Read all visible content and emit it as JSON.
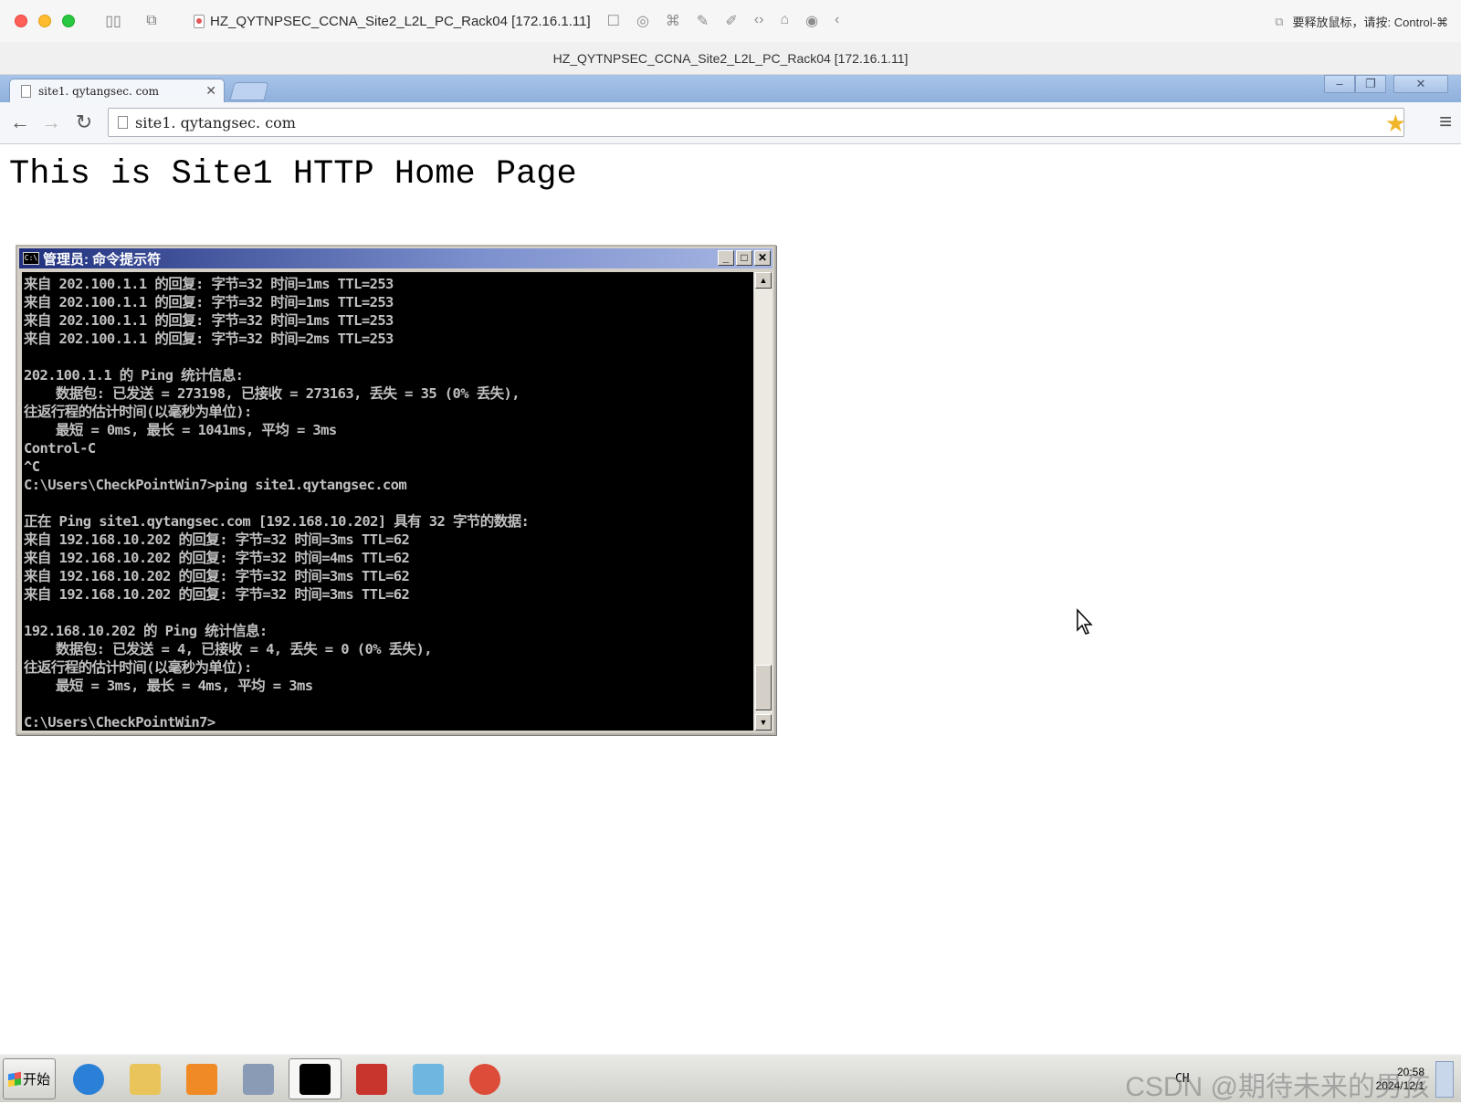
{
  "host_window": {
    "tab_title": "HZ_QYTNPSEC_CCNA_Site2_L2L_PC_Rack04 [172.16.1.11]",
    "subtitle": "HZ_QYTNPSEC_CCNA_Site2_L2L_PC_Rack04 [172.16.1.11]",
    "release_hint": "要释放鼠标，请按: Control-⌘"
  },
  "browser": {
    "tab_label": "site1. qytangsec. com",
    "address": "site1. qytangsec. com",
    "win_buttons": [
      "–",
      "❐",
      "✕"
    ]
  },
  "page": {
    "heading": "This is Site1 HTTP Home Page"
  },
  "cmd": {
    "title": "管理员: 命令提示符",
    "lines": [
      "来自 202.100.1.1 的回复: 字节=32 时间=1ms TTL=253",
      "来自 202.100.1.1 的回复: 字节=32 时间=1ms TTL=253",
      "来自 202.100.1.1 的回复: 字节=32 时间=1ms TTL=253",
      "来自 202.100.1.1 的回复: 字节=32 时间=2ms TTL=253",
      "",
      "202.100.1.1 的 Ping 统计信息:",
      "    数据包: 已发送 = 273198, 已接收 = 273163, 丢失 = 35 (0% 丢失),",
      "往返行程的估计时间(以毫秒为单位):",
      "    最短 = 0ms, 最长 = 1041ms, 平均 = 3ms",
      "Control-C",
      "^C",
      "C:\\Users\\CheckPointWin7>ping site1.qytangsec.com",
      "",
      "正在 Ping site1.qytangsec.com [192.168.10.202] 具有 32 字节的数据:",
      "来自 192.168.10.202 的回复: 字节=32 时间=3ms TTL=62",
      "来自 192.168.10.202 的回复: 字节=32 时间=4ms TTL=62",
      "来自 192.168.10.202 的回复: 字节=32 时间=3ms TTL=62",
      "来自 192.168.10.202 的回复: 字节=32 时间=3ms TTL=62",
      "",
      "192.168.10.202 的 Ping 统计信息:",
      "    数据包: 已发送 = 4, 已接收 = 4, 丢失 = 0 (0% 丢失),",
      "往返行程的估计时间(以毫秒为单位):",
      "    最短 = 3ms, 最长 = 4ms, 平均 = 3ms",
      "",
      "C:\\Users\\CheckPointWin7>"
    ]
  },
  "taskbar": {
    "start_label": "开始",
    "apps": [
      {
        "name": "internet-explorer",
        "color": "#2a7fd6"
      },
      {
        "name": "file-explorer",
        "color": "#e8c45a"
      },
      {
        "name": "media-player",
        "color": "#f08a24"
      },
      {
        "name": "control-panel",
        "color": "#8a9bb5"
      },
      {
        "name": "command-prompt",
        "color": "#000000"
      },
      {
        "name": "network-tool",
        "color": "#c8352c"
      },
      {
        "name": "notepad",
        "color": "#6fb7e0"
      },
      {
        "name": "chrome",
        "color": "#dd4b39"
      }
    ],
    "language": "CH",
    "clock_time": "20:58",
    "clock_date": "2024/12/1",
    "watermark": "CSDN @期待未来的男孩"
  }
}
